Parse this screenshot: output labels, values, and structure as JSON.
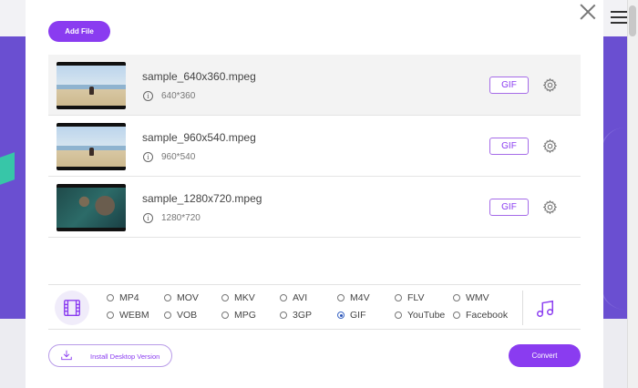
{
  "dialog": {
    "add_file_label": "Add File",
    "install_label": "Install Desktop Version",
    "convert_label": "Convert"
  },
  "files": [
    {
      "name": "sample_640x360.mpeg",
      "resolution": "640*360",
      "format": "GIF",
      "thumb": "beach"
    },
    {
      "name": "sample_960x540.mpeg",
      "resolution": "960*540",
      "format": "GIF",
      "thumb": "beach"
    },
    {
      "name": "sample_1280x720.mpeg",
      "resolution": "1280*720",
      "format": "GIF",
      "thumb": "ocean"
    }
  ],
  "formats": {
    "row1": [
      "MP4",
      "MOV",
      "MKV",
      "AVI",
      "M4V",
      "FLV",
      "WMV"
    ],
    "row2": [
      "WEBM",
      "VOB",
      "MPG",
      "3GP",
      "GIF",
      "YouTube",
      "Facebook"
    ],
    "selected": "GIF"
  },
  "icons": {
    "close": "close-icon",
    "info": "info-icon",
    "settings": "gear-icon",
    "video": "film-icon",
    "audio": "music-note-icon",
    "download": "download-icon"
  },
  "colors": {
    "accent": "#8a3cf0",
    "background_purple": "#6a4fd1"
  }
}
